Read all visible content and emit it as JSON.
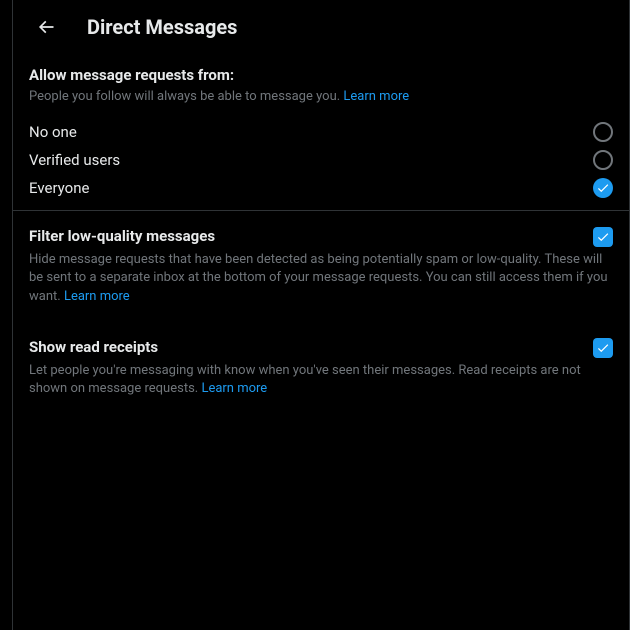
{
  "header": {
    "title": "Direct Messages"
  },
  "allowSection": {
    "title": "Allow message requests from:",
    "desc": "People you follow will always be able to message you. ",
    "learnMore": "Learn more",
    "options": [
      {
        "label": "No one",
        "checked": false
      },
      {
        "label": "Verified users",
        "checked": false
      },
      {
        "label": "Everyone",
        "checked": true
      }
    ]
  },
  "filterSection": {
    "title": "Filter low-quality messages",
    "desc": "Hide message requests that have been detected as being potentially spam or low-quality. These will be sent to a separate inbox at the bottom of your message requests. You can still access them if you want. ",
    "learnMore": "Learn more",
    "checked": true
  },
  "receiptsSection": {
    "title": "Show read receipts",
    "desc": "Let people you're messaging with know when you've seen their messages. Read receipts are not shown on message requests. ",
    "learnMore": "Learn more",
    "checked": true
  },
  "colors": {
    "accent": "#1d9bf0"
  }
}
